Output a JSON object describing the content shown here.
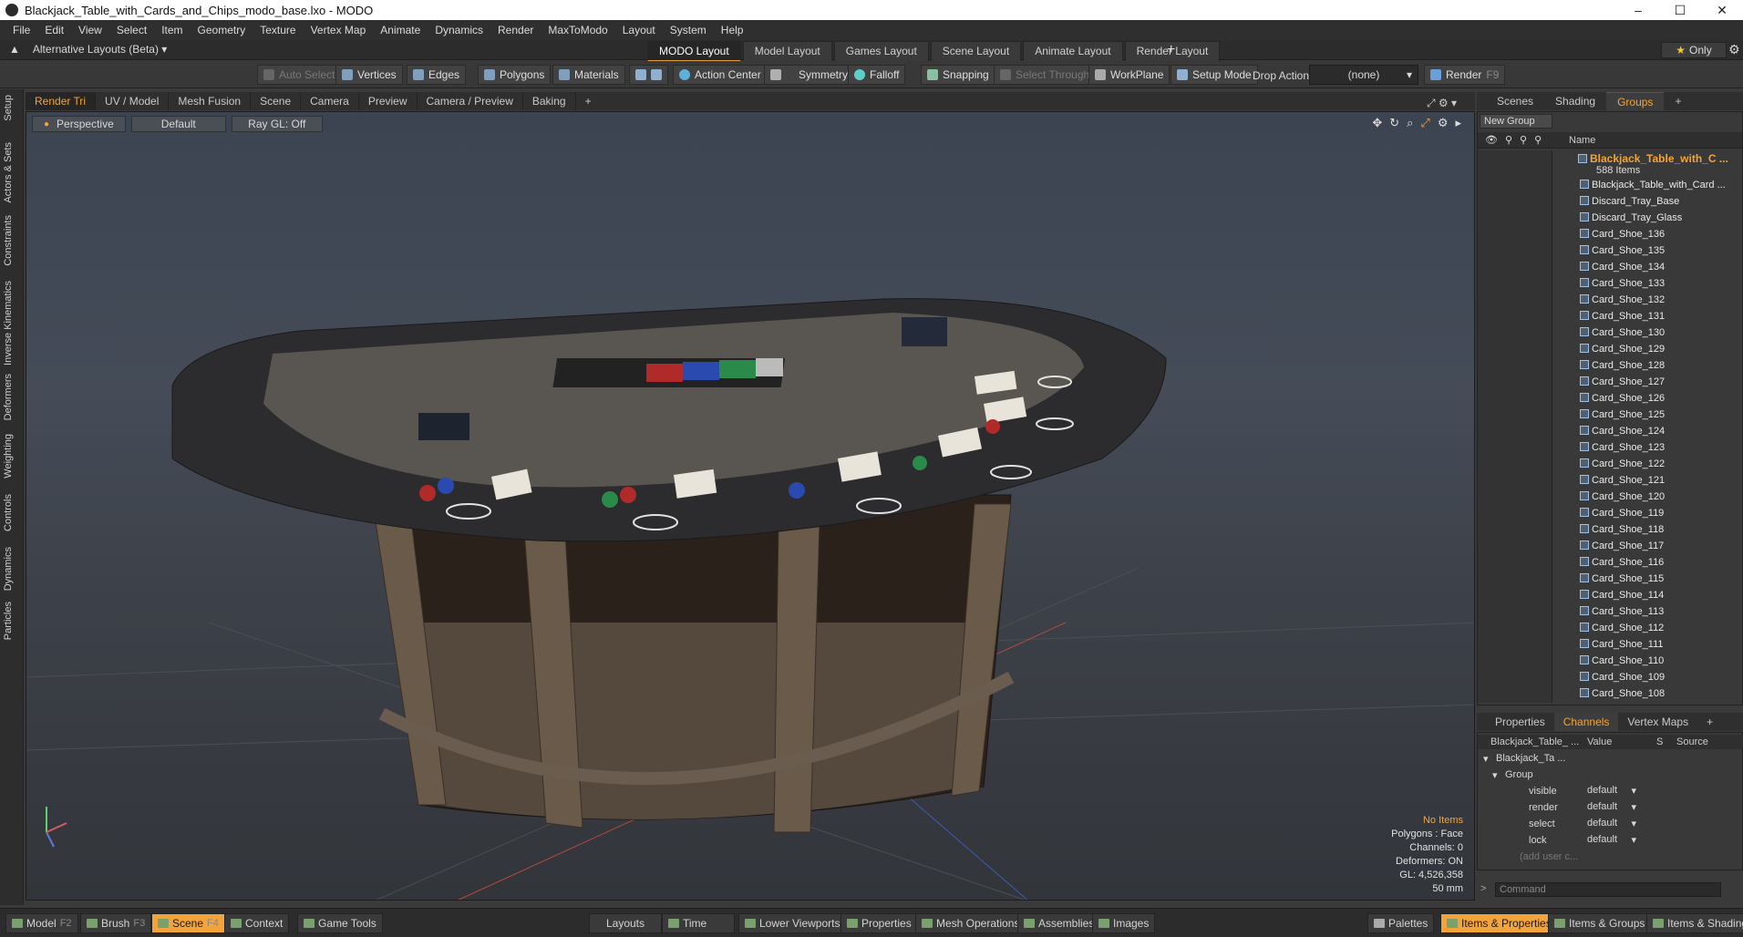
{
  "window": {
    "title": "Blackjack_Table_with_Cards_and_Chips_modo_base.lxo - MODO",
    "min": "–",
    "max": "☐",
    "close": "✕"
  },
  "menu": [
    "File",
    "Edit",
    "View",
    "Select",
    "Item",
    "Geometry",
    "Texture",
    "Vertex Map",
    "Animate",
    "Dynamics",
    "Render",
    "MaxToModo",
    "Layout",
    "System",
    "Help"
  ],
  "layouts": {
    "alt_label": "Alternative Layouts (Beta) ▾",
    "tabs": [
      "MODO Layout",
      "Model Layout",
      "Games Layout",
      "Scene Layout",
      "Animate Layout",
      "Render Layout"
    ],
    "active": "MODO Layout",
    "plus": "+",
    "only": "Only",
    "star": "★"
  },
  "toolbar": {
    "auto_select": "Auto Select",
    "vertices": "Vertices",
    "edges": "Edges",
    "polygons": "Polygons",
    "materials": "Materials",
    "action_center": "Action Center",
    "symmetry": "Symmetry",
    "falloff": "Falloff",
    "snapping": "Snapping",
    "select_through": "Select Through",
    "workplane": "WorkPlane",
    "setup_mode": "Setup Mode",
    "drop_action": "Drop Action",
    "drop_value": "(none)",
    "render": "Render",
    "render_key": "F9"
  },
  "left_tabs": [
    "Setup",
    "Actors & Sets",
    "Constraints",
    "Inverse Kinematics",
    "Deformers",
    "Weighting",
    "Controls",
    "Dynamics",
    "Particles"
  ],
  "viewport_tabs": [
    "Render Tri",
    "UV / Model",
    "Mesh Fusion",
    "Scene",
    "Camera",
    "Preview",
    "Camera / Preview",
    "Baking"
  ],
  "viewport": {
    "view": "Perspective",
    "style": "Default",
    "raygl": "Ray GL: Off",
    "info": {
      "items": "No Items",
      "polygons": "Polygons : Face",
      "channels": "Channels: 0",
      "deformers": "Deformers: ON",
      "gl": "GL: 4,526,358",
      "mm": "50 mm"
    }
  },
  "right_tabs": [
    "Scenes",
    "Shading",
    "Groups"
  ],
  "groups": {
    "new_group": "New Group",
    "name_col": "Name",
    "root": "Blackjack_Table_with_C ...",
    "count": "588 Items",
    "items": [
      "Blackjack_Table_with_Card ...",
      "Discard_Tray_Base",
      "Discard_Tray_Glass",
      "Card_Shoe_136",
      "Card_Shoe_135",
      "Card_Shoe_134",
      "Card_Shoe_133",
      "Card_Shoe_132",
      "Card_Shoe_131",
      "Card_Shoe_130",
      "Card_Shoe_129",
      "Card_Shoe_128",
      "Card_Shoe_127",
      "Card_Shoe_126",
      "Card_Shoe_125",
      "Card_Shoe_124",
      "Card_Shoe_123",
      "Card_Shoe_122",
      "Card_Shoe_121",
      "Card_Shoe_120",
      "Card_Shoe_119",
      "Card_Shoe_118",
      "Card_Shoe_117",
      "Card_Shoe_116",
      "Card_Shoe_115",
      "Card_Shoe_114",
      "Card_Shoe_113",
      "Card_Shoe_112",
      "Card_Shoe_111",
      "Card_Shoe_110",
      "Card_Shoe_109",
      "Card_Shoe_108"
    ]
  },
  "channel_tabs": [
    "Properties",
    "Channels",
    "Vertex Maps"
  ],
  "channels": {
    "head_name": "Blackjack_Table_ ...",
    "head_value": "Value",
    "head_s": "S",
    "head_source": "Source",
    "item": "Blackjack_Ta ...",
    "group": "Group",
    "rows": [
      {
        "name": "visible",
        "value": "default"
      },
      {
        "name": "render",
        "value": "default"
      },
      {
        "name": "select",
        "value": "default"
      },
      {
        "name": "lock",
        "value": "default"
      }
    ],
    "add": "(add user c..."
  },
  "command_placeholder": "Command",
  "statusbar": {
    "model": "Model",
    "model_key": "F2",
    "brush": "Brush",
    "brush_key": "F3",
    "scene": "Scene",
    "scene_key": "F4",
    "context": "Context",
    "game_tools": "Game Tools",
    "layouts": "Layouts",
    "time": "Time",
    "lower_viewports": "Lower Viewports",
    "properties": "Properties",
    "mesh_operations": "Mesh Operations",
    "assemblies": "Assemblies",
    "images": "Images",
    "palettes": "Palettes",
    "items_properties": "Items & Properties",
    "items_groups": "Items & Groups",
    "items_shading": "Items & Shading"
  },
  "colors": {
    "accent": "#f2a43a",
    "panel": "#393939",
    "bg": "#2c2c2c"
  }
}
